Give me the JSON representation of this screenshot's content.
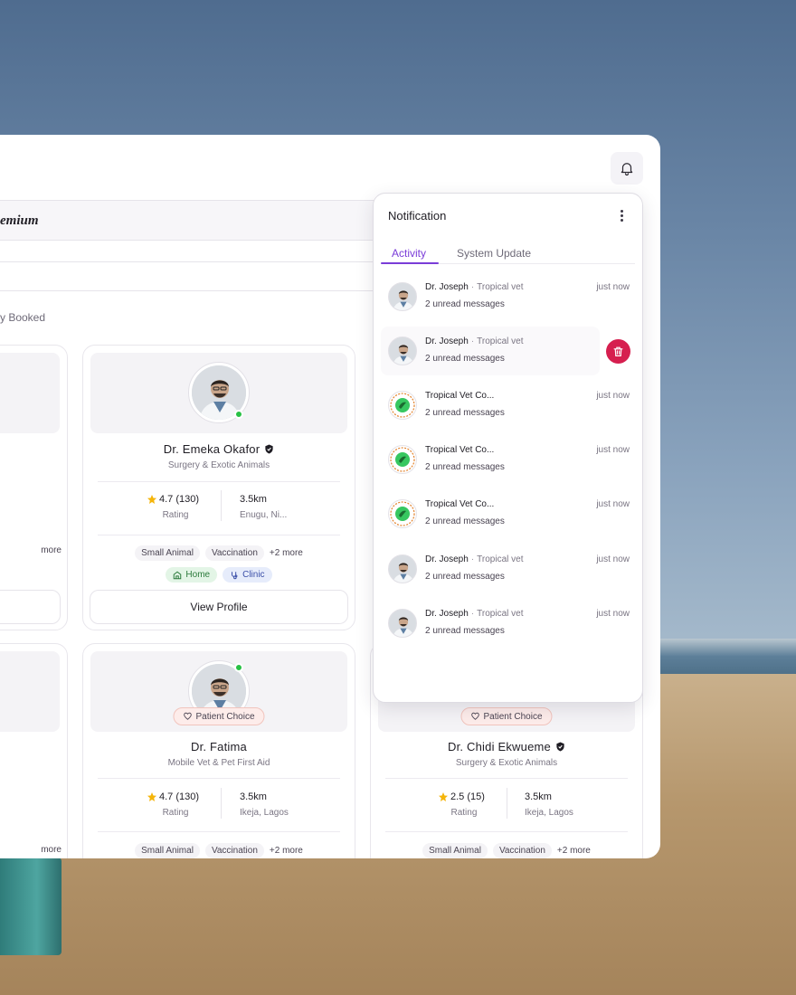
{
  "header": {
    "premium_label": "emium",
    "booked_label": "y Booked"
  },
  "cards": {
    "card_a_more": "more",
    "card_d_more": "more",
    "emeka": {
      "name": "Dr. Emeka Okafor",
      "specialty": "Surgery & Exotic Animals",
      "rating": "4.7 (130)",
      "rating_label": "Rating",
      "distance": "3.5km",
      "location": "Enugu, Ni...",
      "tags": [
        "Small Animal",
        "Vaccination"
      ],
      "more": "+2 more",
      "home_label": "Home",
      "clinic_label": "Clinic",
      "view_profile": "View Profile"
    },
    "fatima": {
      "badge": "Patient Choice",
      "name": "Dr. Fatima",
      "specialty": "Mobile Vet & Pet First Aid",
      "rating": "4.7 (130)",
      "rating_label": "Rating",
      "distance": "3.5km",
      "location": "Ikeja, Lagos",
      "tags": [
        "Small Animal",
        "Vaccination"
      ],
      "more": "+2 more"
    },
    "chidi": {
      "badge": "Patient Choice",
      "name": "Dr. Chidi Ekwueme",
      "specialty": "Surgery & Exotic Animals",
      "rating": "2.5 (15)",
      "rating_label": "Rating",
      "distance": "3.5km",
      "location": "Ikeja, Lagos",
      "tags": [
        "Small Animal",
        "Vaccination"
      ],
      "more": "+2 more"
    }
  },
  "notification": {
    "title": "Notification",
    "tabs": [
      {
        "label": "Activity",
        "active": true
      },
      {
        "label": "System Update",
        "active": false
      }
    ],
    "items": [
      {
        "sender": "Dr. Joseph",
        "sub": "Tropical vet",
        "message": "2 unread messages",
        "time": "just now",
        "avatar": "doctor"
      },
      {
        "sender": "Dr. Joseph",
        "sub": "Tropical vet",
        "message": "2 unread messages",
        "time": "",
        "avatar": "doctor"
      },
      {
        "sender": "Tropical Vet Co...",
        "sub": "",
        "message": "2 unread messages",
        "time": "just now",
        "avatar": "logo"
      },
      {
        "sender": "Tropical Vet Co...",
        "sub": "",
        "message": "2 unread messages",
        "time": "just now",
        "avatar": "logo"
      },
      {
        "sender": "Tropical Vet Co...",
        "sub": "",
        "message": "2 unread messages",
        "time": "just now",
        "avatar": "logo"
      },
      {
        "sender": "Dr. Joseph",
        "sub": "Tropical vet",
        "message": "2 unread messages",
        "time": "just now",
        "avatar": "doctor"
      },
      {
        "sender": "Dr. Joseph",
        "sub": "Tropical vet",
        "message": "2 unread messages",
        "time": "just now",
        "avatar": "doctor"
      }
    ]
  },
  "colors": {
    "accent": "#7a3cd8",
    "delete": "#d61f4f",
    "online": "#28c145",
    "star": "#f5b50a"
  },
  "icons": [
    "bell-icon",
    "more-vertical-icon",
    "trash-icon",
    "verified-icon",
    "star-icon",
    "heart-badge-icon",
    "home-icon",
    "clinic-icon"
  ]
}
